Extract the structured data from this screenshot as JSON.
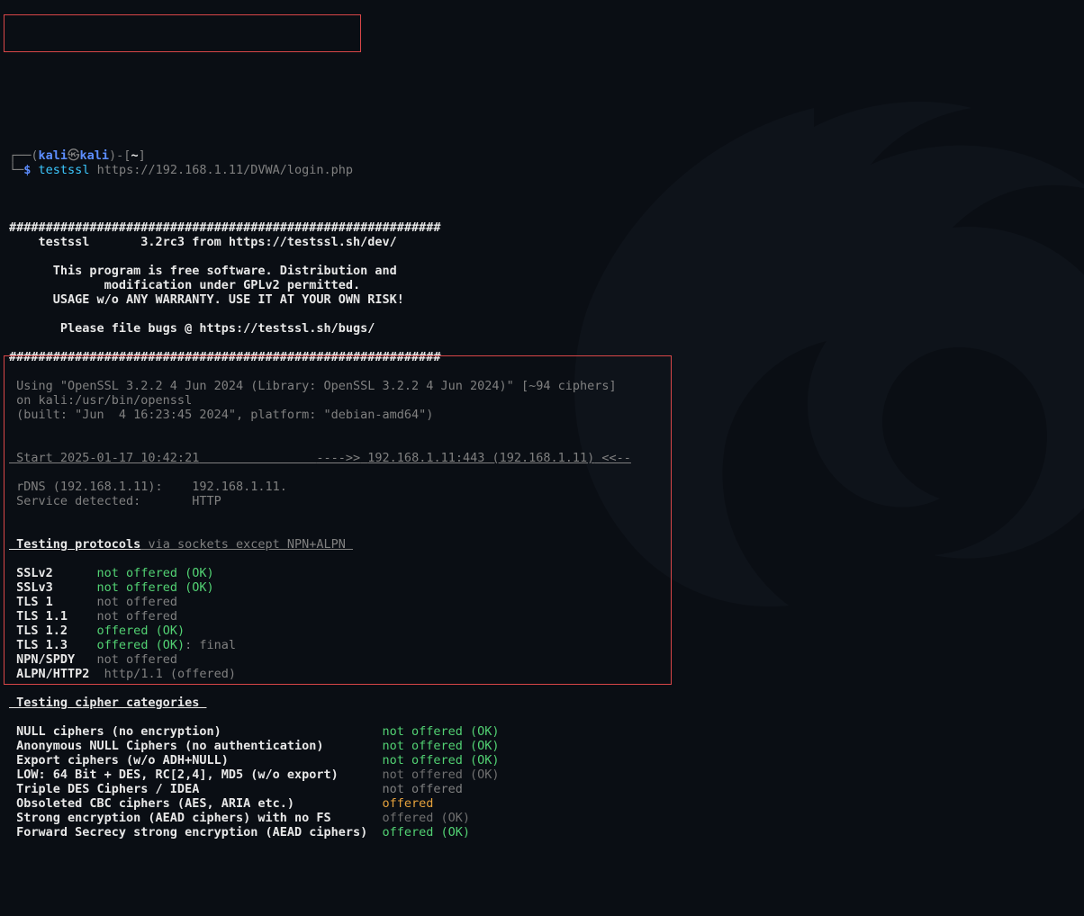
{
  "prompt": {
    "user": "kali",
    "at": "㉿",
    "host": "kali",
    "path": "~",
    "sigil": "$",
    "cmd": "testssl",
    "args": "https://192.168.1.11/DVWA/login.php"
  },
  "banner": {
    "hr": "###########################################################",
    "l1": "    testssl       3.2rc3 from https://testssl.sh/dev/",
    "l2": "      This program is free software. Distribution and",
    "l3": "             modification under GPLv2 permitted.",
    "l4": "      USAGE w/o ANY WARRANTY. USE IT AT YOUR OWN RISK!",
    "l5": "       Please file bugs @ https://testssl.sh/bugs/"
  },
  "openssl": {
    "l1": " Using \"OpenSSL 3.2.2 4 Jun 2024 (Library: OpenSSL 3.2.2 4 Jun 2024)\" [~94 ciphers]",
    "l2": " on kali:/usr/bin/openssl",
    "l3": " (built: \"Jun  4 16:23:45 2024\", platform: \"debian-amd64\")"
  },
  "start": {
    "label": " Start 2025-01-17 10:42:21",
    "arrow_in": "---->>",
    "target": "192.168.1.11:443 (192.168.1.11)",
    "arrow_out": "<<--"
  },
  "service": {
    "l1": " rDNS (192.168.1.11):    192.168.1.11.",
    "l2": " Service detected:       HTTP"
  },
  "protocols_hdr": {
    "main": " Testing protocols",
    "suffix": " via sockets except NPN+ALPN "
  },
  "protocols": [
    {
      "name": " SSLv2     ",
      "status": "not offered (OK)",
      "cls": "green",
      "extra": ""
    },
    {
      "name": " SSLv3     ",
      "status": "not offered (OK)",
      "cls": "green",
      "extra": ""
    },
    {
      "name": " TLS 1     ",
      "status": "not offered",
      "cls": "gray",
      "extra": ""
    },
    {
      "name": " TLS 1.1   ",
      "status": "not offered",
      "cls": "gray",
      "extra": ""
    },
    {
      "name": " TLS 1.2   ",
      "status": "offered (OK)",
      "cls": "green",
      "extra": ""
    },
    {
      "name": " TLS 1.3   ",
      "status": "offered (OK)",
      "cls": "green",
      "extra": ": final"
    },
    {
      "name": " NPN/SPDY  ",
      "status": "not offered",
      "cls": "gray",
      "extra": ""
    },
    {
      "name": " ALPN/HTTP2",
      "status": " http/1.1 (offered)",
      "cls": "gray",
      "extra": ""
    }
  ],
  "ciphers_hdr": " Testing cipher categories ",
  "ciphers": [
    {
      "name": " NULL ciphers (no encryption)                      ",
      "status": "not offered (OK)",
      "cls": "green"
    },
    {
      "name": " Anonymous NULL Ciphers (no authentication)        ",
      "status": "not offered (OK)",
      "cls": "green"
    },
    {
      "name": " Export ciphers (w/o ADH+NULL)                     ",
      "status": "not offered (OK)",
      "cls": "green"
    },
    {
      "name": " LOW: 64 Bit + DES, RC[2,4], MD5 (w/o export)      ",
      "status": "not offered (OK)",
      "cls": "dimgray"
    },
    {
      "name": " Triple DES Ciphers / IDEA                         ",
      "status": "not offered",
      "cls": "gray"
    },
    {
      "name": " Obsoleted CBC ciphers (AES, ARIA etc.)            ",
      "status": "offered",
      "cls": "orange"
    },
    {
      "name": " Strong encryption (AEAD ciphers) with no FS       ",
      "status": "offered (OK)",
      "cls": "dimgray"
    },
    {
      "name": " Forward Secrecy strong encryption (AEAD ciphers)  ",
      "status": "offered (OK)",
      "cls": "green"
    }
  ]
}
